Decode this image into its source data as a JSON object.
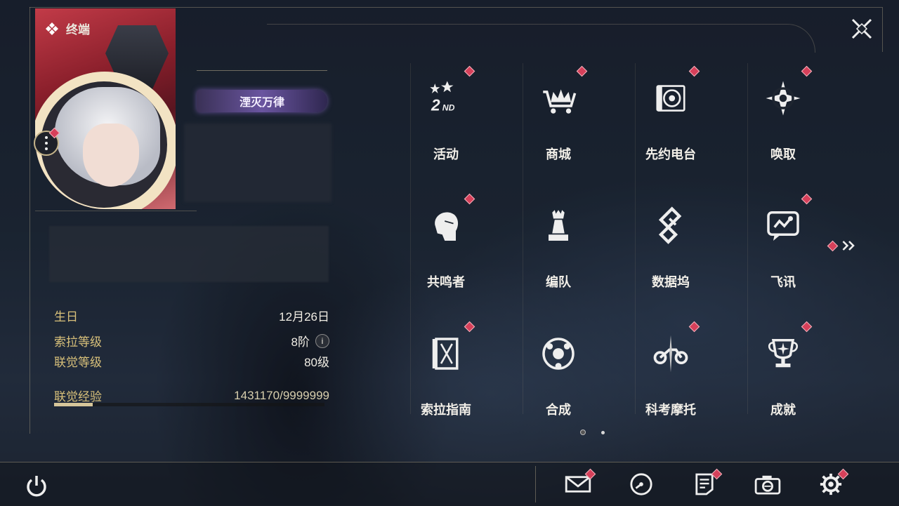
{
  "header": {
    "title": "终端"
  },
  "profile": {
    "title_badge": "湮灭万律",
    "info": [
      {
        "label": "生日",
        "value": "12月26日"
      },
      {
        "label": "索拉等级",
        "value": "8阶"
      },
      {
        "label": "联觉等级",
        "value": "80级"
      },
      {
        "label": "联觉经验",
        "value": "1431170/9999999"
      }
    ],
    "exp_progress": 0.143
  },
  "menu": {
    "items": [
      {
        "label": "活动",
        "icon": "event-2nd-icon",
        "badge": true
      },
      {
        "label": "商城",
        "icon": "crown-cart-icon",
        "badge": true
      },
      {
        "label": "先约电台",
        "icon": "radio-icon",
        "badge": true
      },
      {
        "label": "唤取",
        "icon": "compass-star-icon",
        "badge": true
      },
      {
        "label": "共鸣者",
        "icon": "character-head-icon",
        "badge": true
      },
      {
        "label": "编队",
        "icon": "chess-piece-icon",
        "badge": false
      },
      {
        "label": "数据坞",
        "icon": "data-dock-icon",
        "badge": false
      },
      {
        "label": "飞讯",
        "icon": "message-chat-icon",
        "badge": true
      },
      {
        "label": "索拉指南",
        "icon": "guide-book-icon",
        "badge": true
      },
      {
        "label": "合成",
        "icon": "synthesis-icon",
        "badge": false
      },
      {
        "label": "科考摩托",
        "icon": "motorbike-icon",
        "badge": true
      },
      {
        "label": "成就",
        "icon": "trophy-icon",
        "badge": true
      }
    ],
    "page_count": 2,
    "current_page": 1
  },
  "bottom": {
    "icons": [
      "mail-icon",
      "clock-icon",
      "notes-icon",
      "camera-icon",
      "settings-gear-icon"
    ]
  },
  "colors": {
    "accent": "#d8c07a",
    "badge": "#d6405a",
    "text": "#f2efe8"
  }
}
